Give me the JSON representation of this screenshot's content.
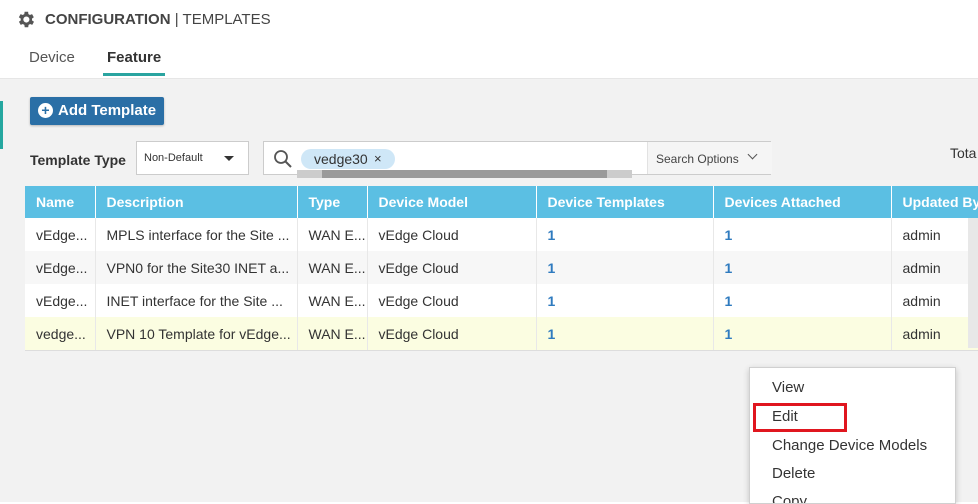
{
  "header": {
    "section": "CONFIGURATION",
    "separator": "|",
    "page": "TEMPLATES"
  },
  "tabs": [
    {
      "label": "Device"
    },
    {
      "label": "Feature"
    }
  ],
  "toolbar": {
    "add_template_label": "Add Template"
  },
  "filter": {
    "template_type_label": "Template Type",
    "template_type_value": "Non-Default",
    "search_chip": "vedge30",
    "search_chip_close": "×",
    "search_options_label": "Search Options"
  },
  "total_label": "Tota",
  "table": {
    "columns": [
      "Name",
      "Description",
      "Type",
      "Device Model",
      "Device Templates",
      "Devices Attached",
      "Updated By"
    ],
    "rows": [
      [
        "vEdge...",
        "MPLS interface for the Site ...",
        "WAN E...",
        "vEdge Cloud",
        "1",
        "1",
        "admin"
      ],
      [
        "vEdge...",
        "VPN0 for the Site30 INET a...",
        "WAN E...",
        "vEdge Cloud",
        "1",
        "1",
        "admin"
      ],
      [
        "vEdge...",
        "INET interface for the Site ...",
        "WAN E...",
        "vEdge Cloud",
        "1",
        "1",
        "admin"
      ],
      [
        "vedge...",
        "VPN 10 Template for vEdge...",
        "WAN E...",
        "vEdge Cloud",
        "1",
        "1",
        "admin"
      ]
    ]
  },
  "context_menu": {
    "items": [
      "View",
      "Edit",
      "Change Device Models",
      "Delete",
      "Copy"
    ]
  },
  "colors": {
    "header_bg": "#5bbfe3",
    "button": "#2a6fa6",
    "accent": "#2aa4a0",
    "link": "#2f7bbf",
    "highlight": "#e0161f"
  }
}
